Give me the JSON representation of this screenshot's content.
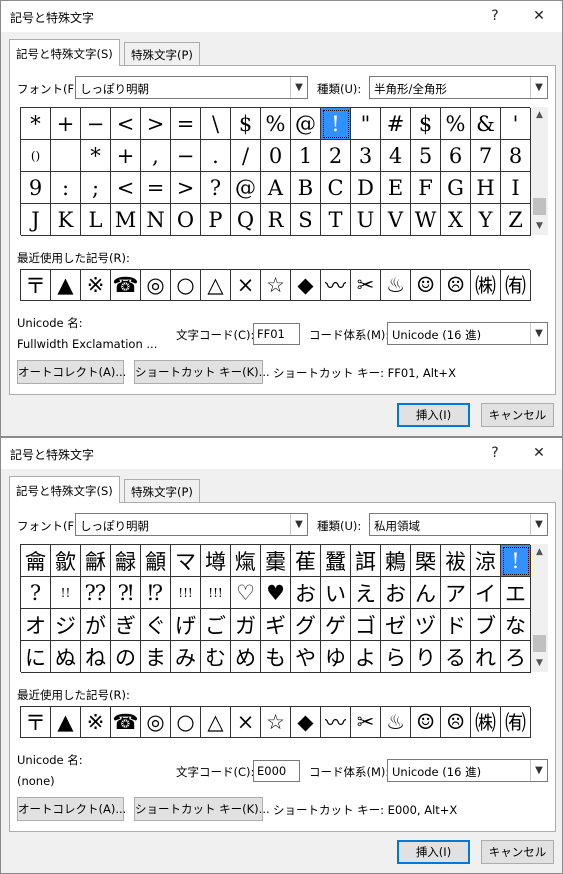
{
  "dialogs": [
    {
      "title": "記号と特殊文字",
      "help_label": "?",
      "close_label": "✕",
      "tabs": [
        "記号と特殊文字(S)",
        "特殊文字(P)"
      ],
      "font_label": "フォント(F):",
      "font_value": "しっぽり明朝",
      "subset_label": "種類(U):",
      "subset_value": "半角形/全角形",
      "symbol_rows": [
        [
          "*",
          "+",
          "−",
          "<",
          ">",
          "=",
          "\\",
          "$",
          "%",
          "@",
          "!",
          "\"",
          "#",
          "$",
          "%",
          "&",
          "'"
        ],
        [
          "()",
          "",
          "*",
          "+",
          ",",
          "−",
          ".",
          "/",
          "0",
          "1",
          "2",
          "3",
          "4",
          "5",
          "6",
          "7",
          "8"
        ],
        [
          "9",
          ":",
          ";",
          "<",
          "=",
          ">",
          "?",
          "@",
          "A",
          "B",
          "C",
          "D",
          "E",
          "F",
          "G",
          "H",
          "I"
        ],
        [
          "J",
          "K",
          "L",
          "M",
          "N",
          "O",
          "P",
          "Q",
          "R",
          "S",
          "T",
          "U",
          "V",
          "W",
          "X",
          "Y",
          "Z"
        ]
      ],
      "selected_cell": "0-10",
      "recent_label": "最近使用した記号(R):",
      "recent_symbols": [
        "〒",
        "▲",
        "※",
        "☎",
        "◎",
        "○",
        "△",
        "×",
        "☆",
        "◆",
        "〰",
        "✂",
        "♨",
        "☺",
        "☹",
        "㈱",
        "㈲"
      ],
      "unicode_name_label": "Unicode 名:",
      "unicode_name_value": "Fullwidth Exclamation ...",
      "char_code_label": "文字コード(C):",
      "char_code_value": "FF01",
      "from_label": "コード体系(M):",
      "from_value": "Unicode (16 進)",
      "autocorrect_label": "オートコレクト(A)...",
      "shortcut_key_label": "ショートカット キー(K)...",
      "shortcut_text": "ショートカット キー: FF01, Alt+X",
      "insert_label": "挿入(I)",
      "cancel_label": "キャンセル"
    },
    {
      "title": "記号と特殊文字",
      "help_label": "?",
      "close_label": "✕",
      "tabs": [
        "記号と特殊文字(S)",
        "特殊文字(P)"
      ],
      "font_label": "フォント(F):",
      "font_value": "しっぽり明朝",
      "subset_label": "種類(U):",
      "subset_value": "私用領域",
      "symbol_rows": [
        [
          "龠",
          "歙",
          "龢",
          "龣",
          "龥",
          "マ",
          "壿",
          "熂",
          "㯱",
          "萑",
          "蠶",
          "誀",
          "鶫",
          "㮣",
          "袚",
          "涼",
          "!"
        ],
        [
          "?",
          "!!",
          "⁇",
          "⁈",
          "⁉",
          "!!!",
          "!!!",
          "♡",
          "♥",
          "お",
          "い",
          "え",
          "お",
          "ん",
          "ア",
          "イ",
          "エ"
        ],
        [
          "オ",
          "ジ",
          "が",
          "ぎ",
          "ぐ",
          "げ",
          "ご",
          "ガ",
          "ギ",
          "グ",
          "ゲ",
          "ゴ",
          "ゼ",
          "ヅ",
          "ド",
          "ブ",
          "な"
        ],
        [
          "に",
          "ぬ",
          "ね",
          "の",
          "ま",
          "み",
          "む",
          "め",
          "も",
          "や",
          "ゆ",
          "よ",
          "ら",
          "り",
          "る",
          "れ",
          "ろ"
        ]
      ],
      "selected_cell": "0-16",
      "recent_label": "最近使用した記号(R):",
      "recent_symbols": [
        "〒",
        "▲",
        "※",
        "☎",
        "◎",
        "○",
        "△",
        "×",
        "☆",
        "◆",
        "〰",
        "✂",
        "♨",
        "☺",
        "☹",
        "㈱",
        "㈲"
      ],
      "unicode_name_label": "Unicode 名:",
      "unicode_name_value": "(none)",
      "char_code_label": "文字コード(C):",
      "char_code_value": "E000",
      "from_label": "コード体系(M):",
      "from_value": "Unicode (16 進)",
      "autocorrect_label": "オートコレクト(A)...",
      "shortcut_key_label": "ショートカット キー(K)...",
      "shortcut_text": "ショートカット キー: E000, Alt+X",
      "insert_label": "挿入(I)",
      "cancel_label": "キャンセル"
    }
  ],
  "colors": {
    "selection": "#3390ff",
    "dialog_bg": "#f0f0f0",
    "primary_border": "#0078d7"
  },
  "icons": {
    "combo_arrow": "chevron-down-icon",
    "scroll_up": "scroll-up-icon",
    "scroll_down": "scroll-down-icon"
  }
}
